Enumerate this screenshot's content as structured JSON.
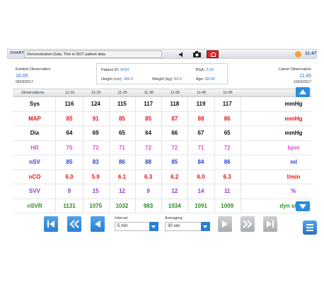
{
  "topbar": {
    "chart_label": "CHART",
    "demo_message": "Demonstration Data. This is NOT patient data",
    "clock": "11:47",
    "colors": {
      "alarm": "#d92b2b",
      "accent": "#2a8de0"
    }
  },
  "info": {
    "earliest_label": "Earliest Observation",
    "earliest_time": "16:05",
    "earliest_date": "09/03/2017",
    "latest_label": "Latest Observation",
    "latest_time": "11:45",
    "latest_date": "10/03/2017"
  },
  "patient": {
    "id_label": "Patient ID:",
    "id_value": "RCN",
    "bsa_label": "BSA:",
    "bsa_value": "2.03",
    "height_label": "Height (cm):",
    "height_value": "180.0",
    "weight_label": "Weight (kg):",
    "weight_value": "83.0",
    "age_label": "Age:",
    "age_value": "58.00"
  },
  "table": {
    "header_label": "Observations",
    "times": [
      "11:15",
      "11:20",
      "11:25",
      "11:30",
      "11:35",
      "11:40",
      "11:45"
    ],
    "rows": [
      {
        "param": "Sys",
        "color": "#111111",
        "values": [
          "116",
          "124",
          "115",
          "117",
          "118",
          "119",
          "117"
        ],
        "unit": "mmHg"
      },
      {
        "param": "MAP",
        "color": "#e01818",
        "values": [
          "85",
          "91",
          "85",
          "85",
          "87",
          "88",
          "86"
        ],
        "unit": "mmHg"
      },
      {
        "param": "Dia",
        "color": "#111111",
        "values": [
          "64",
          "69",
          "65",
          "64",
          "66",
          "67",
          "65"
        ],
        "unit": "mmHg"
      },
      {
        "param": "HR",
        "color": "#ee48d8",
        "values": [
          "70",
          "72",
          "71",
          "72",
          "72",
          "71",
          "72"
        ],
        "unit": "bpm"
      },
      {
        "param": "nSV",
        "color": "#2a3fd8",
        "values": [
          "85",
          "83",
          "86",
          "88",
          "85",
          "84",
          "86"
        ],
        "unit": "ml"
      },
      {
        "param": "nCO",
        "color": "#e01818",
        "values": [
          "6.0",
          "5.9",
          "6.1",
          "6.3",
          "6.2",
          "6.0",
          "6.3"
        ],
        "unit": "l/min"
      },
      {
        "param": "SVV",
        "color": "#8a3ae0",
        "values": [
          "8",
          "15",
          "12",
          "9",
          "12",
          "14",
          "11"
        ],
        "unit": "%"
      },
      {
        "param": "nSVR",
        "color": "#2e8b22",
        "values": [
          "1131",
          "1075",
          "1032",
          "983",
          "1034",
          "1091",
          "1009"
        ],
        "unit": "dyn s/cm5"
      }
    ]
  },
  "controls": {
    "interval_label": "Interval",
    "interval_value": "5 min",
    "averaging_label": "Averaging",
    "averaging_value": "30 sec"
  }
}
